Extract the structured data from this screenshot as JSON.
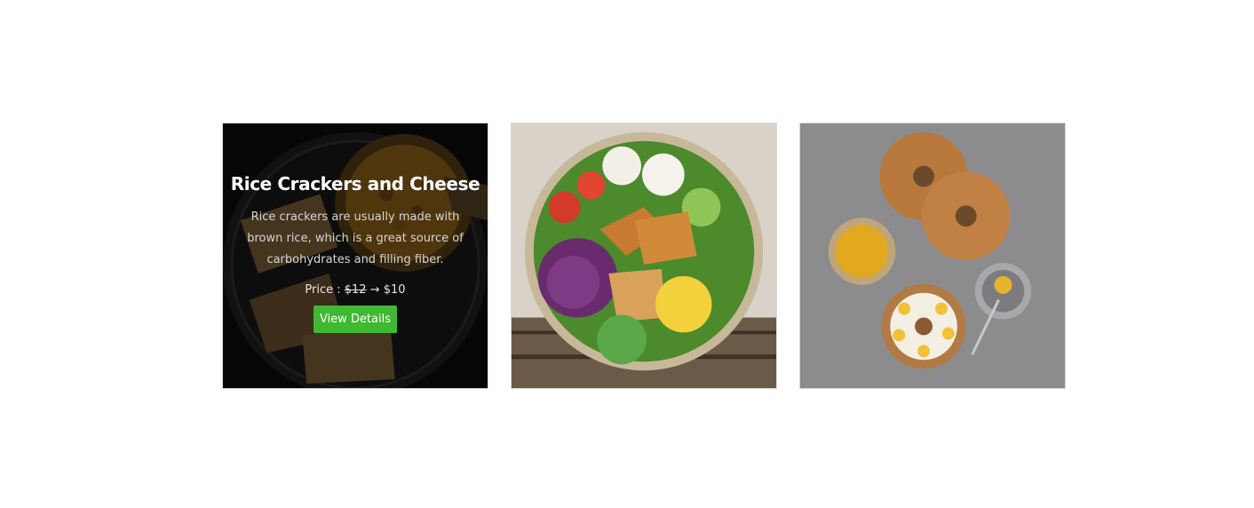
{
  "cards": [
    {
      "title": "Rice Crackers and Cheese",
      "description": "Rice crackers are usually made with brown rice, which is a great source of carbohydrates and filling fiber.",
      "price_label": "Price : ",
      "old_price": "$12",
      "arrow": "→",
      "new_price": "$10",
      "button_label": "View Details",
      "image_icon": "rice-crackers-soup-photo"
    },
    {
      "image_icon": "salad-bowl-photo"
    },
    {
      "image_icon": "bagels-photo"
    }
  ],
  "colors": {
    "button": "#3fb832",
    "overlay_text": "#ffffff"
  }
}
